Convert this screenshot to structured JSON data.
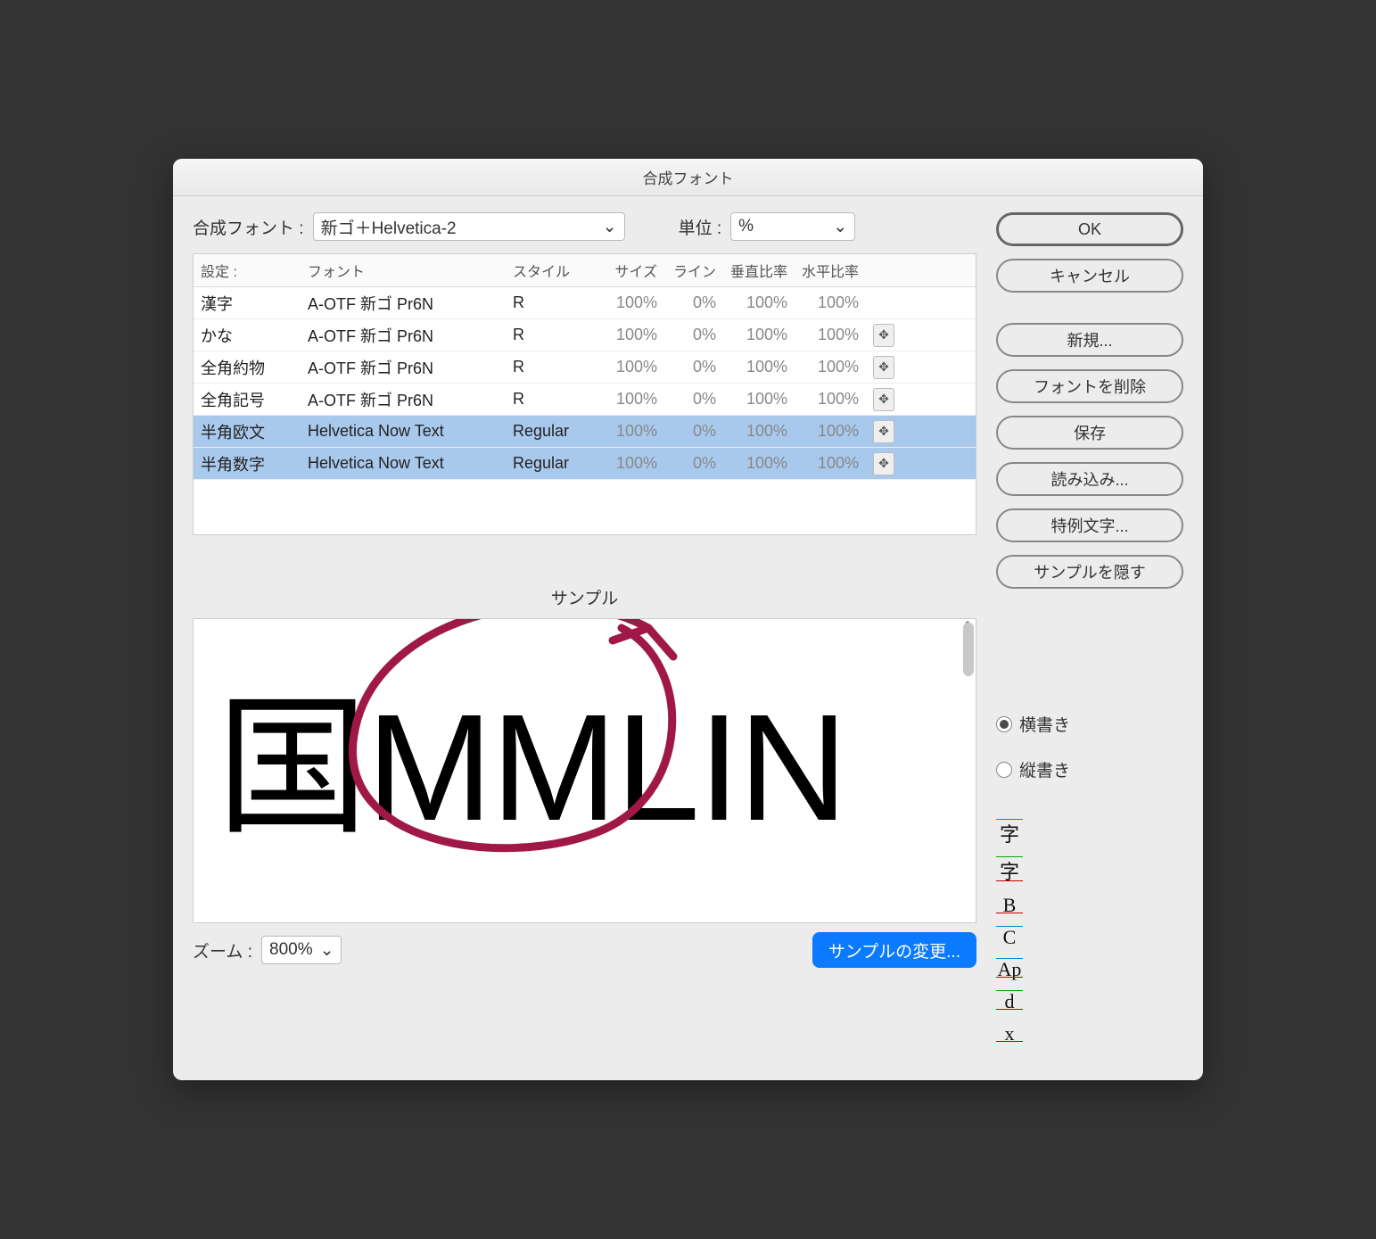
{
  "window": {
    "title": "合成フォント"
  },
  "top": {
    "composite_label": "合成フォント :",
    "composite_value": "新ゴ＋Helvetica-2",
    "unit_label": "単位 :",
    "unit_value": "%"
  },
  "table": {
    "headers": {
      "set": "設定 :",
      "font": "フォント",
      "style": "スタイル",
      "size": "サイズ",
      "line": "ライン",
      "vert": "垂直比率",
      "horz": "水平比率"
    },
    "rows": [
      {
        "set": "漢字",
        "font": "A-OTF 新ゴ Pr6N",
        "style": "R",
        "size": "100%",
        "line": "0%",
        "vert": "100%",
        "horz": "100%",
        "move": false,
        "selected": false
      },
      {
        "set": "かな",
        "font": "A-OTF 新ゴ Pr6N",
        "style": "R",
        "size": "100%",
        "line": "0%",
        "vert": "100%",
        "horz": "100%",
        "move": true,
        "selected": false
      },
      {
        "set": "全角約物",
        "font": "A-OTF 新ゴ Pr6N",
        "style": "R",
        "size": "100%",
        "line": "0%",
        "vert": "100%",
        "horz": "100%",
        "move": true,
        "selected": false
      },
      {
        "set": "全角記号",
        "font": "A-OTF 新ゴ Pr6N",
        "style": "R",
        "size": "100%",
        "line": "0%",
        "vert": "100%",
        "horz": "100%",
        "move": true,
        "selected": false
      },
      {
        "set": "半角欧文",
        "font": "Helvetica Now Text",
        "style": "Regular",
        "size": "100%",
        "line": "0%",
        "vert": "100%",
        "horz": "100%",
        "move": true,
        "selected": true
      },
      {
        "set": "半角数字",
        "font": "Helvetica Now Text",
        "style": "Regular",
        "size": "100%",
        "line": "0%",
        "vert": "100%",
        "horz": "100%",
        "move": true,
        "selected": true
      }
    ]
  },
  "buttons": {
    "ok": "OK",
    "cancel": "キャンセル",
    "new": "新規...",
    "delete": "フォントを削除",
    "save": "保存",
    "load": "読み込み...",
    "special": "特例文字...",
    "hide_sample": "サンプルを隠す",
    "change_sample": "サンプルの変更..."
  },
  "sample": {
    "label": "サンプル",
    "text_kanji": "国",
    "text_latin": "MMLIN",
    "horizontal": "横書き",
    "vertical": "縦書き",
    "guides": [
      "字",
      "字",
      "B",
      "C",
      "Ap",
      "d",
      "x"
    ]
  },
  "zoom": {
    "label": "ズーム :",
    "value": "800%"
  }
}
